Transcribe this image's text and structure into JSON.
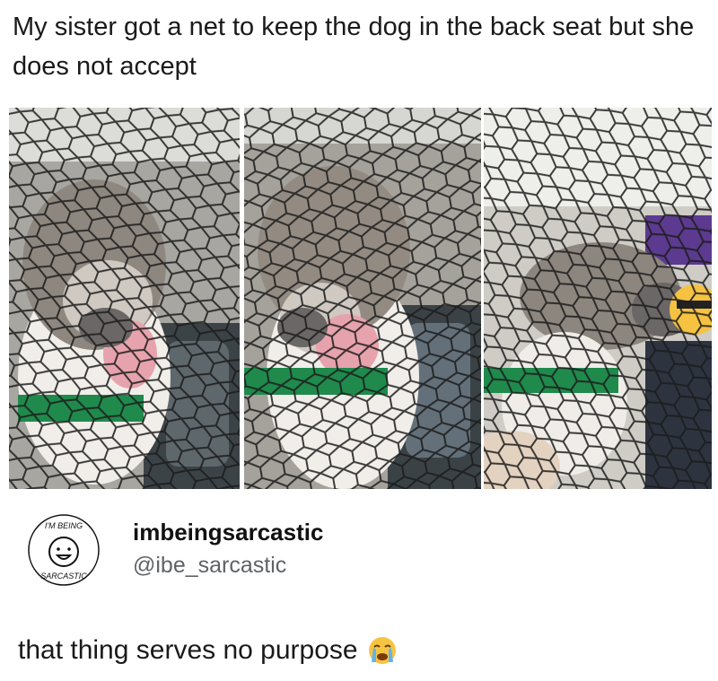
{
  "post": {
    "caption": "My sister got a net to keep the dog in the back seat but she does not accept"
  },
  "photos": [
    {
      "icon": "dog-photo-1"
    },
    {
      "icon": "dog-photo-2"
    },
    {
      "icon": "dog-photo-3"
    }
  ],
  "tweet": {
    "avatar_text_top": "I'M BEING",
    "avatar_text_bottom": "SARCASTIC",
    "username": "imbeingsarcastic",
    "handle": "@ibe_sarcastic",
    "text": "that thing serves no purpose",
    "emoji": "crying-face-emoji"
  }
}
